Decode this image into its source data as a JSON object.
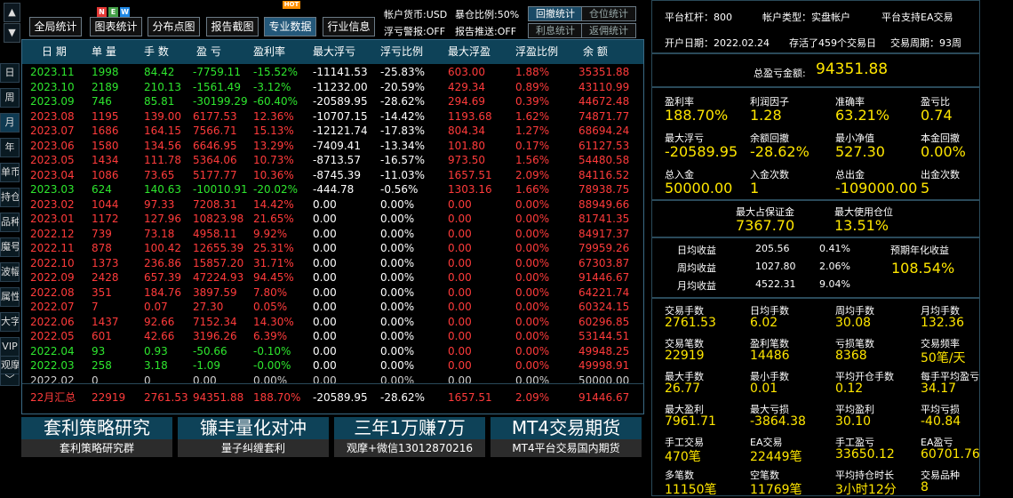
{
  "nav": {
    "up_arrow": "▲",
    "down_arrow": "▼",
    "expand": "﹀"
  },
  "period_tabs": [
    "日",
    "周",
    "月",
    "年",
    "单币",
    "持仓",
    "品种",
    "魔号",
    "波幅",
    "属性",
    "大字",
    "VIP",
    "观摩"
  ],
  "toolbar": {
    "buttons": [
      "全局统计",
      "图表统计",
      "分布点图",
      "报告截图",
      "专业数据",
      "行业信息"
    ],
    "badge_new": [
      "N",
      "E",
      "W"
    ],
    "badge_hot": "HOT",
    "currency": "帐户货币:USD",
    "exposure": "暴仓比例:50%",
    "float_warn": "浮亏警报:OFF",
    "report_push": "报告推送:OFF",
    "small_buttons": [
      "回撤统计",
      "仓位统计",
      "利息统计",
      "返佣统计"
    ]
  },
  "table": {
    "headers": [
      "日 期",
      "单 量",
      "手 数",
      "盈 亏",
      "盈利率",
      "最大浮亏",
      "浮亏比例",
      "最大浮盈",
      "浮盈比例",
      "余 额"
    ],
    "rows": [
      [
        "2023.11",
        "1998",
        "84.42",
        "-7759.11",
        "-15.52%",
        "-11141.53",
        "-25.83%",
        "603.00",
        "1.88%",
        "35351.88"
      ],
      [
        "2023.10",
        "2189",
        "210.13",
        "-1561.49",
        "-3.12%",
        "-11232.00",
        "-20.59%",
        "429.34",
        "0.89%",
        "43110.99"
      ],
      [
        "2023.09",
        "746",
        "85.81",
        "-30199.29",
        "-60.40%",
        "-20589.95",
        "-28.62%",
        "294.69",
        "0.39%",
        "44672.48"
      ],
      [
        "2023.08",
        "1195",
        "139.00",
        "6177.53",
        "12.36%",
        "-10707.15",
        "-14.42%",
        "1193.68",
        "1.62%",
        "74871.77"
      ],
      [
        "2023.07",
        "1686",
        "164.15",
        "7566.71",
        "15.13%",
        "-12121.74",
        "-17.83%",
        "804.34",
        "1.27%",
        "68694.24"
      ],
      [
        "2023.06",
        "1580",
        "134.56",
        "6646.95",
        "13.29%",
        "-7409.41",
        "-13.34%",
        "101.80",
        "0.17%",
        "61127.53"
      ],
      [
        "2023.05",
        "1434",
        "111.78",
        "5364.06",
        "10.73%",
        "-8713.57",
        "-16.57%",
        "973.50",
        "1.56%",
        "54480.58"
      ],
      [
        "2023.04",
        "1086",
        "73.65",
        "5177.77",
        "10.36%",
        "-8745.39",
        "-11.03%",
        "1657.51",
        "2.09%",
        "84116.52"
      ],
      [
        "2023.03",
        "624",
        "140.63",
        "-10010.91",
        "-20.02%",
        "-444.78",
        "-0.56%",
        "1303.16",
        "1.66%",
        "78938.75"
      ],
      [
        "2023.02",
        "1044",
        "97.33",
        "7208.31",
        "14.42%",
        "0.00",
        "0.00%",
        "0.00",
        "0.00%",
        "88949.66"
      ],
      [
        "2023.01",
        "1172",
        "127.96",
        "10823.98",
        "21.65%",
        "0.00",
        "0.00%",
        "0.00",
        "0.00%",
        "81741.35"
      ],
      [
        "2022.12",
        "739",
        "73.18",
        "4958.11",
        "9.92%",
        "0.00",
        "0.00%",
        "0.00",
        "0.00%",
        "84917.37"
      ],
      [
        "2022.11",
        "878",
        "100.42",
        "12655.39",
        "25.31%",
        "0.00",
        "0.00%",
        "0.00",
        "0.00%",
        "79959.26"
      ],
      [
        "2022.10",
        "1373",
        "236.86",
        "15857.20",
        "31.71%",
        "0.00",
        "0.00%",
        "0.00",
        "0.00%",
        "67303.87"
      ],
      [
        "2022.09",
        "2428",
        "657.39",
        "47224.93",
        "94.45%",
        "0.00",
        "0.00%",
        "0.00",
        "0.00%",
        "91446.67"
      ],
      [
        "2022.08",
        "351",
        "184.76",
        "3897.59",
        "7.80%",
        "0.00",
        "0.00%",
        "0.00",
        "0.00%",
        "64221.74"
      ],
      [
        "2022.07",
        "7",
        "0.07",
        "27.30",
        "0.05%",
        "0.00",
        "0.00%",
        "0.00",
        "0.00%",
        "60324.15"
      ],
      [
        "2022.06",
        "1437",
        "92.66",
        "7152.34",
        "14.30%",
        "0.00",
        "0.00%",
        "0.00",
        "0.00%",
        "60296.85"
      ],
      [
        "2022.05",
        "601",
        "42.66",
        "3196.26",
        "6.39%",
        "0.00",
        "0.00%",
        "0.00",
        "0.00%",
        "53144.51"
      ],
      [
        "2022.04",
        "93",
        "0.93",
        "-50.66",
        "-0.10%",
        "0.00",
        "0.00%",
        "0.00",
        "0.00%",
        "49948.25"
      ],
      [
        "2022.03",
        "258",
        "3.18",
        "-1.09",
        "-0.00%",
        "0.00",
        "0.00%",
        "0.00",
        "0.00%",
        "49998.91"
      ],
      [
        "2022.02",
        "0",
        "0",
        "0.00",
        "0.00%",
        "0.00",
        "0.00%",
        "0.00",
        "0.00%",
        "50000.00"
      ]
    ],
    "summary": [
      "22月汇总",
      "22919",
      "2761.53",
      "94351.88",
      "188.70%",
      "-20589.95",
      "-28.62%",
      "1657.51",
      "2.09%",
      "91446.67"
    ]
  },
  "banners": [
    {
      "title": "套利策略研究",
      "sub": "套利策略研究群"
    },
    {
      "title": "镰丰量化对冲",
      "sub": "量子纠缠套利"
    },
    {
      "title": "三年1万赚7万",
      "sub": "观摩+微信13012870216"
    },
    {
      "title": "MT4交易期货",
      "sub": "MT4平台交易国内期货"
    }
  ],
  "info": {
    "leverage": "平台杠杆：800",
    "account_type": "帐户类型：实盘帐户",
    "ea_support": "平台支持EA交易",
    "open_date": "开户日期：2022.02.24",
    "alive_days": "存活了459个交易日",
    "trade_cycle": "交易周期：93周"
  },
  "total": {
    "label": "总盈亏金额:",
    "value": "94351.88"
  },
  "metrics_a": [
    {
      "label": "盈利率",
      "value": "188.70%"
    },
    {
      "label": "利润因子",
      "value": "1.28"
    },
    {
      "label": "准确率",
      "value": "63.21%"
    },
    {
      "label": "盈亏比",
      "value": "0.74"
    },
    {
      "label": "最大浮亏",
      "value": "-20589.95"
    },
    {
      "label": "余额回撤",
      "value": "-28.62%"
    },
    {
      "label": "最小净值",
      "value": "527.30"
    },
    {
      "label": "本金回撤",
      "value": "0.00%"
    },
    {
      "label": "总入金",
      "value": "50000.00"
    },
    {
      "label": "入金次数",
      "value": "1"
    },
    {
      "label": "总出金",
      "value": "-109000.00"
    },
    {
      "label": "出金次数",
      "value": "5"
    }
  ],
  "margin": [
    {
      "label": "最大占保证金",
      "value": "7367.70"
    },
    {
      "label": "最大使用仓位",
      "value": "13.51%"
    }
  ],
  "returns": {
    "rows": [
      {
        "label": "日均收益",
        "amount": "205.56",
        "pct": "0.41%"
      },
      {
        "label": "周均收益",
        "amount": "1027.80",
        "pct": "2.06%"
      },
      {
        "label": "月均收益",
        "amount": "4522.31",
        "pct": "9.04%"
      }
    ],
    "annual_label": "预期年化收益",
    "annual_value": "108.54%"
  },
  "metrics_b": [
    {
      "label": "交易手数",
      "value": "2761.53"
    },
    {
      "label": "日均手数",
      "value": "6.02"
    },
    {
      "label": "周均手数",
      "value": "30.08"
    },
    {
      "label": "月均手数",
      "value": "132.36"
    },
    {
      "label": "交易笔数",
      "value": "22919"
    },
    {
      "label": "盈利笔数",
      "value": "14486"
    },
    {
      "label": "亏损笔数",
      "value": "8368"
    },
    {
      "label": "交易频率",
      "value": "50笔/天"
    },
    {
      "label": "最大手数",
      "value": "26.77"
    },
    {
      "label": "最小手数",
      "value": "0.01"
    },
    {
      "label": "平均开仓手数",
      "value": "0.12"
    },
    {
      "label": "每手平均盈亏",
      "value": "34.17"
    },
    {
      "label": "最大盈利",
      "value": "7961.71"
    },
    {
      "label": "最大亏损",
      "value": "-3864.38"
    },
    {
      "label": "平均盈利",
      "value": "30.10"
    },
    {
      "label": "平均亏损",
      "value": "-40.84"
    },
    {
      "label": "手工交易",
      "value": "470笔"
    },
    {
      "label": "EA交易",
      "value": "22449笔"
    },
    {
      "label": "手工盈亏",
      "value": "33650.12"
    },
    {
      "label": "EA盈亏",
      "value": "60701.76"
    },
    {
      "label": "多笔数",
      "value": "11150笔"
    },
    {
      "label": "空笔数",
      "value": "11769笔"
    },
    {
      "label": "平均持仓时长",
      "value": "3小时12分"
    },
    {
      "label": "交易品种",
      "value": "8"
    }
  ]
}
